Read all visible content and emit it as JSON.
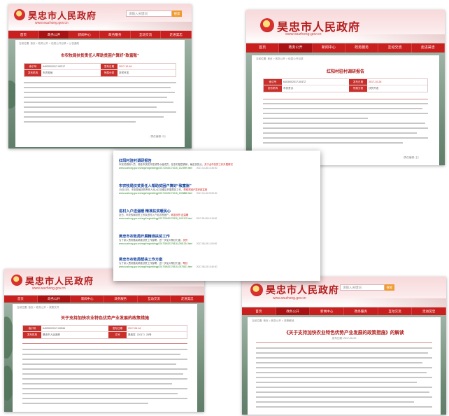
{
  "site": {
    "name": "昊忠市人民政府",
    "url": "www.wuzhong.gov.cn",
    "search_placeholder": "请输入关键词",
    "search_button": "搜索"
  },
  "nav": [
    "首页",
    "政务公开",
    "新闻中心",
    "政务服务",
    "互动交流",
    "走进昊忠"
  ],
  "panels": {
    "top_left": {
      "breadcrumb": "当前位置: 首页 > 政务公开 > 信息公开目录 > 公告通知",
      "title": "市农牧局扶贫责任人帮助贫困户算好“致富账”",
      "meta": [
        {
          "k1": "索引号",
          "v1": "640300/2017-00317",
          "k2": "发布日期",
          "v2": "2017-10-16"
        },
        {
          "k1": "发布机构",
          "v1": "市农牧局",
          "k2": "所属分类",
          "v2": "扶贫开发"
        }
      ],
      "footer": "（责任编辑: 马）",
      "tabs_label": "打印本页"
    },
    "top_right": {
      "breadcrumb": "当前位置: 首页 > 政务公开 > 信息公开目录",
      "title": "红阳村驻村调研报告",
      "meta": [
        {
          "k1": "索引号",
          "v1": "640300/2017-00472",
          "k2": "发布日期",
          "v2": "2017-10-26"
        },
        {
          "k1": "发布机构",
          "v1": "市扶贫办",
          "k2": "所属分类",
          "v2": "扶贫开发"
        }
      ],
      "footer": "（责任编辑: 王）"
    },
    "bottom_left": {
      "breadcrumb": "当前位置: 首页 > 政务公开 > 政策文件",
      "title": "关于支持加快农业特色优势产业发展的政策措施",
      "meta": [
        {
          "k1": "索引号",
          "v1": "640300/2017-00596",
          "k2": "发布日期",
          "v2": "2017-06-16"
        },
        {
          "k1": "发布机构",
          "v1": "昊忠市人民政府",
          "k2": "文号",
          "v2": "昊政发〔2017〕28号"
        }
      ]
    },
    "bottom_right": {
      "breadcrumb": "当前位置: 首页 > 政务公开 > 政策解读",
      "title": "《关于支持加快农业特色优势产业发展的政策措施》的解读",
      "date_line": "发布日期: 2017-06-20"
    }
  },
  "search_results": [
    {
      "title": "红阳村驻村调研报告",
      "snippet_pre": "市农村调研人员，现任市扶贫开发领导小组成员，在农村基层调研，确定扶贫点，",
      "snippet_hl": "关于全市扶贫工作开展情况",
      "url": "www.wuzhong.gov.cn/zwgk/xxgkml/tzgg/201710/t20171026_1024999.html",
      "date": "2017-10-26 10:30:00"
    },
    {
      "title": "市农牧局扶贫责任人帮助贫困户算好“致富账”",
      "snippet_pre": "10月13日，市农牧局扶贫责任人深入红寺堡区开展帮扶工作，",
      "snippet_hl": "帮助贫困户算好致富账",
      "url": "www.wuzhong.gov.cn/zwgk/xxgkml/tzgg/201710/t20171016_1008888.html",
      "date": "2017-10-16 09:20:00"
    },
    {
      "title": "进村入户送温暖 精准扶贫暖民心",
      "snippet_pre": "近日，市农牧局扶贫工作队进村入户走访贫困户，",
      "snippet_hl": "精准扶贫 送温暖",
      "url": "www.wuzhong.gov.cn/zwgk/xxgkml/tzgg/201709/t20170928_1001122.html",
      "date": "2017-09-28 16:15:00"
    },
    {
      "title": "吴忠市农牧局开展精准扶贫工作",
      "snippet_pre": "为了深入贯彻落实精准扶贫工作部署，进一步加大帮扶力度，",
      "snippet_hl": "扶贫",
      "url": "www.wuzhong.gov.cn/zwgk/xxgkml/tzgg/201708/t20170818_0981234.html",
      "date": "2017-08-18 11:00:00"
    },
    {
      "title": "吴忠市农牧局帮扶工作方案",
      "snippet_pre": "为了深入贯彻落实精准扶贫工作部署，进一步加大帮扶力度，",
      "snippet_hl": "帮扶",
      "url": "www.wuzhong.gov.cn/zwgk/xxgkml/tzgg/201708/t20170815_0975521.html",
      "date": "2017-08-15 10:40:00"
    }
  ]
}
